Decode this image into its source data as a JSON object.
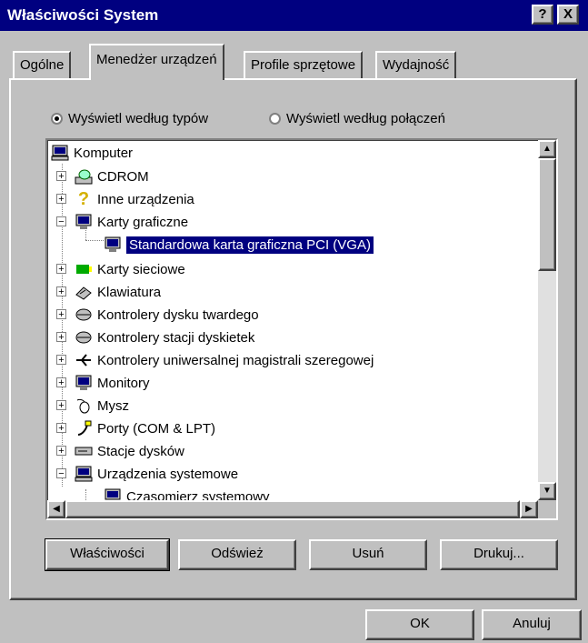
{
  "window": {
    "title": "Właściwości System",
    "help_label": "?",
    "close_label": "X"
  },
  "tabs": [
    {
      "label": "Ogólne"
    },
    {
      "label": "Menedżer urządzeń"
    },
    {
      "label": "Profile sprzętowe"
    },
    {
      "label": "Wydajność"
    }
  ],
  "view_options": {
    "by_type": "Wyświetl według typów",
    "by_connection": "Wyświetl według połączeń",
    "selected": "by_type"
  },
  "tree": {
    "root": "Komputer",
    "items": [
      {
        "label": "CDROM",
        "icon": "cdrom-icon"
      },
      {
        "label": "Inne urządzenia",
        "icon": "question-icon"
      },
      {
        "label": "Karty graficzne",
        "icon": "monitor-icon",
        "expanded": true
      },
      {
        "label": "Standardowa karta graficzna PCI (VGA)",
        "icon": "monitor-icon",
        "selected": true
      },
      {
        "label": "Karty sieciowe",
        "icon": "network-card-icon"
      },
      {
        "label": "Klawiatura",
        "icon": "keyboard-icon"
      },
      {
        "label": "Kontrolery dysku twardego",
        "icon": "disk-controller-icon"
      },
      {
        "label": "Kontrolery stacji dyskietek",
        "icon": "floppy-controller-icon"
      },
      {
        "label": "Kontrolery uniwersalnej magistrali szeregowej",
        "icon": "usb-icon"
      },
      {
        "label": "Monitory",
        "icon": "monitor-icon"
      },
      {
        "label": "Mysz",
        "icon": "mouse-icon"
      },
      {
        "label": "Porty (COM & LPT)",
        "icon": "port-icon"
      },
      {
        "label": "Stacje dysków",
        "icon": "drive-icon"
      },
      {
        "label": "Urządzenia systemowe",
        "icon": "computer-icon",
        "expanded": true
      },
      {
        "label": "Czasomierz systemowy",
        "icon": "computer-icon"
      }
    ]
  },
  "buttons": {
    "properties": "Właściwości",
    "refresh": "Odśwież",
    "remove": "Usuń",
    "print": "Drukuj...",
    "ok": "OK",
    "cancel": "Anuluj"
  },
  "colors": {
    "titlebar": "#000080",
    "face": "#c0c0c0",
    "selection": "#000080"
  }
}
